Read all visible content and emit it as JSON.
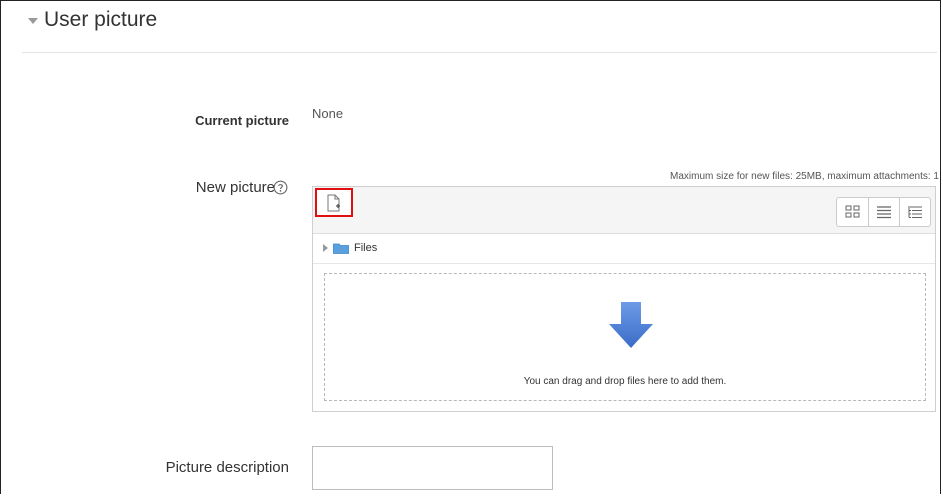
{
  "section": {
    "title": "User picture",
    "collapse_icon": "caret-down-icon"
  },
  "current_picture": {
    "label": "Current picture",
    "value": "None"
  },
  "new_picture": {
    "label": "New picture",
    "help_icon": "help-icon",
    "max_size_text": "Maximum size for new files: 25MB, maximum attachments: 1"
  },
  "filepicker": {
    "toolbar": {
      "add_icon": "add-file-icon",
      "views": [
        "icons-view-icon",
        "list-view-icon",
        "tree-view-icon"
      ]
    },
    "path": {
      "folder_label": "Files",
      "folder_icon": "folder-icon"
    },
    "dropzone": {
      "text": "You can drag and drop files here to add them.",
      "arrow_icon": "down-arrow-icon"
    }
  },
  "picture_description": {
    "label": "Picture description",
    "value": ""
  },
  "colors": {
    "highlight": "#e01010",
    "arrow_blue": "#4a7fd4",
    "folder_blue": "#5aa0de"
  }
}
